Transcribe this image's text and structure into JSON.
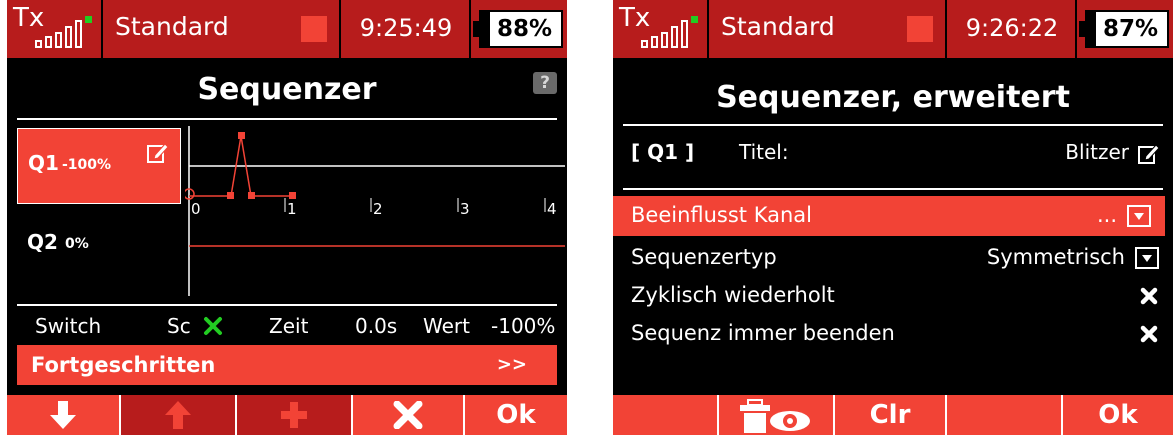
{
  "left": {
    "status": {
      "tx_label": "Tx",
      "model": "Standard",
      "time": "9:25:49",
      "battery": "88%"
    },
    "title": "Sequenzer",
    "help_icon": "?",
    "sequences": [
      {
        "name": "Q1",
        "value": "-100%"
      },
      {
        "name": "Q2",
        "value": "0%"
      }
    ],
    "graph_ticks": [
      "0",
      "1",
      "2",
      "3",
      "4"
    ],
    "info": {
      "switch_label": "Switch",
      "switch_value": "Sc",
      "time_label": "Zeit",
      "time_value": "0.0s",
      "value_label": "Wert",
      "value_value": "-100%"
    },
    "advanced": {
      "label": "Fortgeschritten",
      "arrow": ">>"
    },
    "softkeys": [
      {
        "icon": "arrow-down-icon",
        "enabled": true
      },
      {
        "icon": "arrow-up-icon",
        "enabled": false
      },
      {
        "icon": "plus-icon",
        "enabled": false
      },
      {
        "icon": "delete-x-icon",
        "enabled": true
      },
      {
        "label": "Ok",
        "enabled": true
      }
    ]
  },
  "right": {
    "status": {
      "tx_label": "Tx",
      "model": "Standard",
      "time": "9:26:22",
      "battery": "87%"
    },
    "title": "Sequenzer, erweitert",
    "header": {
      "id": "[ Q1 ]",
      "title_label": "Titel:",
      "title_value": "Blitzer"
    },
    "rows": [
      {
        "label": "Beeinflusst Kanal",
        "value": "...",
        "control": "dropdown",
        "selected": true
      },
      {
        "label": "Sequenzertyp",
        "value": "Symmetrisch",
        "control": "dropdown",
        "selected": false
      },
      {
        "label": "Zyklisch wiederholt",
        "value": "",
        "control": "checkbox-x",
        "selected": false
      },
      {
        "label": "Sequenz immer beenden",
        "value": "",
        "control": "checkbox-x",
        "selected": false
      }
    ],
    "softkeys": [
      {
        "label": ""
      },
      {
        "icon": "trash-eye-icon"
      },
      {
        "label": "Clr"
      },
      {
        "label": ""
      },
      {
        "label": "Ok"
      }
    ]
  },
  "colors": {
    "bar_dark": "#b71c1c",
    "accent": "#f24336",
    "background": "#000000",
    "text": "#ffffff",
    "check_green": "#22cc22"
  }
}
